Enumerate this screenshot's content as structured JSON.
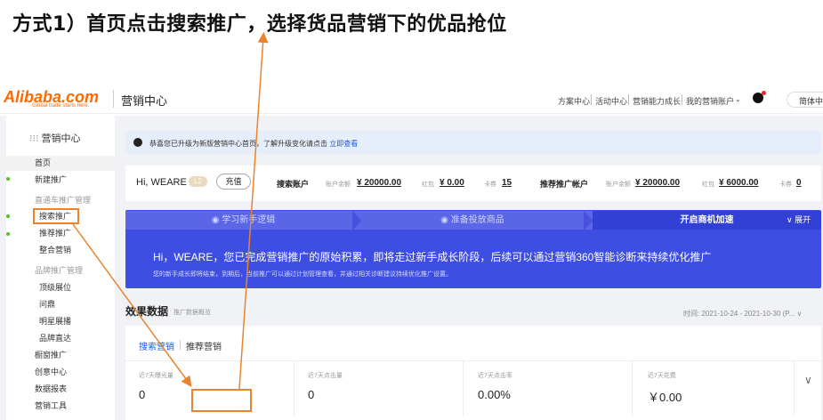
{
  "annotation": {
    "title": "方式1）首页点击搜索推广，选择货品营销下的优品抢位"
  },
  "topbar": {
    "logo_text": "Alibaba.com",
    "logo_tagline": "Global trade starts here.",
    "title": "营销中心",
    "nav": [
      "方案中心",
      "活动中心",
      "营销能力成长",
      "我的营销账户"
    ],
    "language": "简体中"
  },
  "sidebar": {
    "header": "营销中心",
    "items": [
      {
        "label": "首页"
      },
      {
        "label": "新建推广"
      },
      {
        "label": "直通车推广管理"
      },
      {
        "label": "搜索推广"
      },
      {
        "label": "推荐推广"
      },
      {
        "label": "整合营销"
      },
      {
        "label": "品牌推广管理"
      },
      {
        "label": "顶级展位"
      },
      {
        "label": "问鼎"
      },
      {
        "label": "明星展播"
      },
      {
        "label": "品牌直达"
      },
      {
        "label": "橱窗推广"
      },
      {
        "label": "创意中心"
      },
      {
        "label": "数据报表"
      },
      {
        "label": "营销工具"
      }
    ]
  },
  "notice": {
    "text": "恭喜您已升级为新版营销中心首页，了解升级变化请点击",
    "link": "立即查看"
  },
  "account": {
    "greeting": "Hi, WEARE",
    "level": "L2",
    "recharge": "充值",
    "search_label": "搜索账户",
    "search_balance_label": "账户余额",
    "search_balance": "¥ 20000.00",
    "search_redpack_label": "红包",
    "search_redpack": "¥ 0.00",
    "search_coupon_label": "卡券",
    "search_coupon": "15",
    "rec_label": "推荐推广帐户",
    "rec_balance_label": "账户余额",
    "rec_balance": "¥ 20000.00",
    "rec_redpack_label": "红包",
    "rec_redpack": "¥ 6000.00",
    "rec_coupon_label": "卡券",
    "rec_coupon": "0"
  },
  "banner": {
    "steps": [
      "学习新手逻辑",
      "准备投放商品",
      "开启商机加速"
    ],
    "expand": "展开",
    "message": "Hi，WEARE，您已完成营销推广的原始积累，即将走过新手成长阶段，后续可以通过营销360智能诊断来持续优化推广",
    "sub": "您的新手成长即将结束，到期后，当前推广可以通过计划管理查看，并通过相关诊断建议持续优化推广设置。"
  },
  "effect": {
    "title": "效果数据",
    "subtitle": "推广数据概览",
    "date_range": "时间: 2021-10-24 - 2021-10-30 (P...",
    "tabs": [
      "搜索营销",
      "推荐营销"
    ],
    "metrics": [
      {
        "label": "近7天曝光量",
        "value": "0"
      },
      {
        "label": "近7天点击量",
        "value": "0"
      },
      {
        "label": "近7天点击率",
        "value": "0.00%"
      },
      {
        "label": "近7天花费",
        "value": "￥0.00"
      }
    ]
  },
  "colors": {
    "accent": "#e8842f",
    "banner": "#3e4ee2",
    "link": "#1a5bd6"
  }
}
